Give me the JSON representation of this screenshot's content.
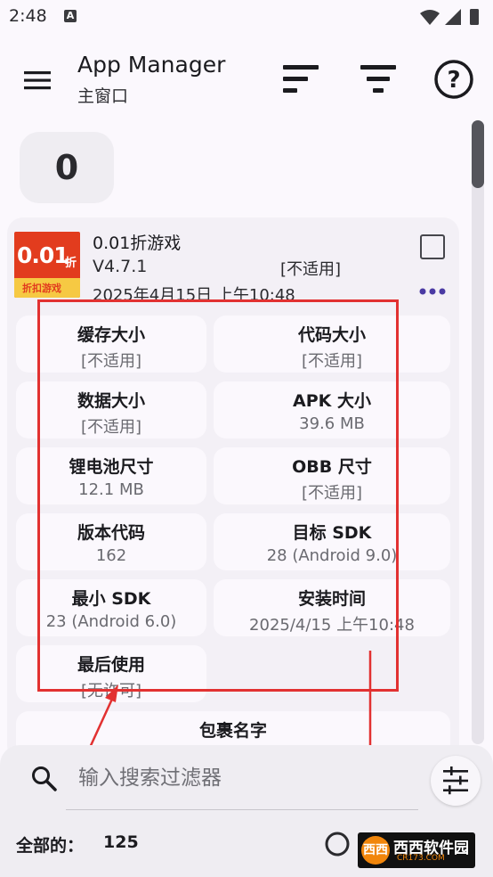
{
  "status_bar": {
    "time": "2:48",
    "notification_badge": "A"
  },
  "app_bar": {
    "title": "App Manager",
    "subtitle": "主窗口",
    "icons": [
      "menu-icon",
      "sort-icon",
      "filter-icon",
      "help-icon"
    ]
  },
  "selection_count": "0",
  "app_card": {
    "logo": {
      "main": "0.01",
      "suffix": "折",
      "sub": "折扣游戏"
    },
    "name": "0.01折游戏",
    "version": "V4.7.1",
    "tag": "[不适用]",
    "date": "2025年4月15日 上午10:48",
    "tiles": [
      {
        "label": "缓存大小",
        "value": "[不适用]"
      },
      {
        "label": "代码大小",
        "value": "[不适用]"
      },
      {
        "label": "数据大小",
        "value": "[不适用]"
      },
      {
        "label": "APK 大小",
        "value": "39.6 MB"
      },
      {
        "label": "锂电池尺寸",
        "value": "12.1 MB"
      },
      {
        "label": "OBB 尺寸",
        "value": "[不适用]"
      },
      {
        "label": "版本代码",
        "value": "162"
      },
      {
        "label": "目标 SDK",
        "value": "28 (Android 9.0)"
      },
      {
        "label": "最小 SDK",
        "value": "23 (Android 6.0)"
      },
      {
        "label": "安装时间",
        "value": "2025/4/15 上午10:48"
      },
      {
        "label": "最后使用",
        "value": "[无许可]"
      }
    ],
    "package_label": "包裹名字"
  },
  "bottom_panel": {
    "search_placeholder": "输入搜索过滤器",
    "total_label": "全部的：",
    "total_value": "125"
  },
  "watermark": {
    "title": "西西软件园",
    "url": "CR173.COM",
    "badge": "西西"
  },
  "annotation_color": "#e23131",
  "accent_color": "#4a3aa3"
}
